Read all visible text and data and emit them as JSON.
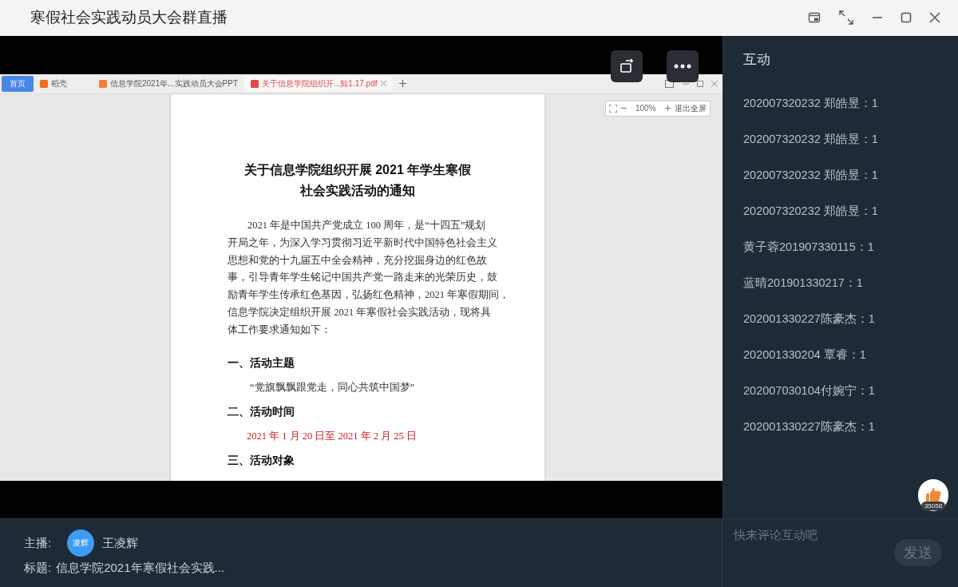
{
  "window": {
    "title": "寒假社会实践动员大会群直播"
  },
  "shared_screen": {
    "tabs": [
      {
        "label": "首页",
        "kind": "home",
        "selected": false
      },
      {
        "label": "稻壳",
        "kind": "docer",
        "selected": false
      },
      {
        "label": "信息学院2021年...实践动员大会PPT",
        "kind": "ppt",
        "selected": false
      },
      {
        "label": "关于信息学院组织开...知1.17.pdf",
        "kind": "pdf",
        "selected": true
      }
    ],
    "zoom": "100%",
    "exit_fullscreen": "退出全屏",
    "document": {
      "title_lines": [
        "关于信息学院组织开展 2021 年学生寒假",
        "社会实践活动的通知"
      ],
      "paragraph_lines": [
        "2021 年是中国共产党成立 100 周年，是“十四五”规划",
        "开局之年，为深入学习贯彻习近平新时代中国特色社会主义",
        "思想和党的十九届五中全会精神，充分挖掘身边的红色故",
        "事，引导青年学生铭记中国共产党一路走来的光荣历史，鼓",
        "励青年学生传承红色基因，弘扬红色精神，2021 年寒假期间，",
        "信息学院决定组织开展 2021 年寒假社会实践活动，现将具",
        "体工作要求通知如下："
      ],
      "sections": [
        {
          "heading": "一、活动主题",
          "body": "“党旗飘飘跟党走，同心共筑中国梦”",
          "kind": "quote"
        },
        {
          "heading": "二、活动时间",
          "body": "2021 年 1 月 20 日至 2021 年 2 月 25 日",
          "kind": "date"
        },
        {
          "heading": "三、活动对象"
        }
      ]
    }
  },
  "interaction": {
    "title": "互动",
    "comments": [
      "202007320232 郑皓昱：1",
      "202007320232 郑皓昱：1",
      "202007320232 郑皓昱：1",
      "202007320232 郑皓昱：1",
      "黄子蓉201907330115：1",
      "蓝晴201901330217：1",
      "202001330227陈豪杰：1",
      "202001330204 覃睿：1",
      "202007030104付婉宁：1",
      "202001330227陈豪杰：1"
    ],
    "like_count": "35058",
    "comment_field": {
      "placeholder": "快来评论互动吧"
    },
    "send_button": {
      "label": "发送",
      "disabled": true
    }
  },
  "footer": {
    "host_label": "主播:",
    "host_avatar": "凌辉",
    "host_name": "王凌辉",
    "title_label": "标题:",
    "title": "信息学院2021年寒假社会实践..."
  }
}
